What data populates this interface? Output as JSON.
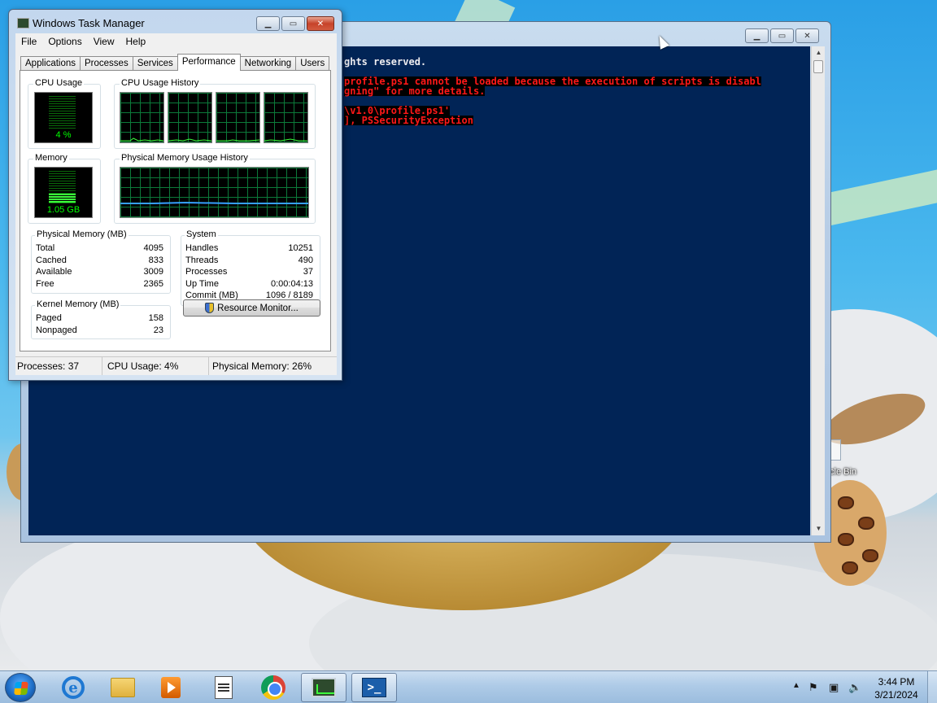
{
  "desktop": {
    "recycle_bin_label": "cle Bin"
  },
  "powershell": {
    "lines": [
      {
        "text": "ghts reserved.",
        "style": "white"
      },
      {
        "text": "profile.ps1 cannot be loaded because the execution of scripts is disabl",
        "style": "red"
      },
      {
        "text": "gning\" for more details.",
        "style": "red"
      },
      {
        "text": "\\v1.0\\profile.ps1'",
        "style": "red"
      },
      {
        "text": "], PSSecurityException",
        "style": "red"
      }
    ],
    "colors": {
      "background": "#012456",
      "error_text": "#ff1818",
      "text": "#eeedf0"
    }
  },
  "task_manager": {
    "title": "Windows Task Manager",
    "menu": [
      "File",
      "Options",
      "View",
      "Help"
    ],
    "tabs": [
      "Applications",
      "Processes",
      "Services",
      "Performance",
      "Networking",
      "Users"
    ],
    "active_tab": "Performance",
    "cpu_usage": {
      "label": "CPU Usage",
      "value": "4 %",
      "percent": 4
    },
    "cpu_history": {
      "label": "CPU Usage History",
      "cores": 4
    },
    "memory": {
      "label": "Memory",
      "value": "1.05 GB",
      "percent": 26
    },
    "memory_history": {
      "label": "Physical Memory Usage History"
    },
    "physical_memory": {
      "label": "Physical Memory (MB)",
      "rows": [
        {
          "name": "Total",
          "value": "4095"
        },
        {
          "name": "Cached",
          "value": "833"
        },
        {
          "name": "Available",
          "value": "3009"
        },
        {
          "name": "Free",
          "value": "2365"
        }
      ]
    },
    "system": {
      "label": "System",
      "rows": [
        {
          "name": "Handles",
          "value": "10251"
        },
        {
          "name": "Threads",
          "value": "490"
        },
        {
          "name": "Processes",
          "value": "37"
        },
        {
          "name": "Up Time",
          "value": "0:00:04:13"
        },
        {
          "name": "Commit (MB)",
          "value": "1096 / 8189"
        }
      ]
    },
    "kernel_memory": {
      "label": "Kernel Memory (MB)",
      "rows": [
        {
          "name": "Paged",
          "value": "158"
        },
        {
          "name": "Nonpaged",
          "value": "23"
        }
      ]
    },
    "resource_monitor_label": "Resource Monitor...",
    "status": {
      "processes": "Processes: 37",
      "cpu": "CPU Usage: 4%",
      "memory": "Physical Memory: 26%"
    }
  },
  "taskbar": {
    "items": [
      {
        "name": "internet-explorer",
        "icon": "ie-icon",
        "active": false
      },
      {
        "name": "windows-explorer",
        "icon": "folder-icon",
        "active": false
      },
      {
        "name": "media-player",
        "icon": "media-icon",
        "active": false
      },
      {
        "name": "notepad",
        "icon": "doc-icon",
        "active": false
      },
      {
        "name": "google-chrome",
        "icon": "chrome-icon",
        "active": false
      },
      {
        "name": "task-manager",
        "icon": "task-manager-icon",
        "active": true
      },
      {
        "name": "powershell",
        "icon": "powershell-icon",
        "active": true
      }
    ],
    "clock_time": "3:44 PM",
    "clock_date": "3/21/2024"
  }
}
